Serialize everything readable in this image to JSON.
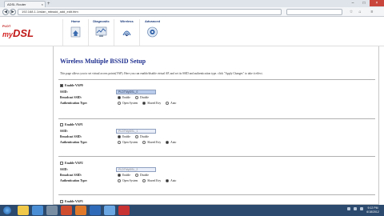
{
  "browser": {
    "tab_title": "ADSL Router",
    "tab_close": "×",
    "new_tab": "+",
    "window_buttons": [
      "–",
      "□",
      "×"
    ],
    "url": "192.168.1.1/wlan_mbssid_add_edit.htm",
    "search_placeholder": "",
    "back": "◀",
    "forward": "▶",
    "tools": [
      "☆",
      "⌂",
      "≡"
    ]
  },
  "router": {
    "logo_small": "PLDT",
    "logo_my": "my",
    "logo_main": "DSL",
    "nav": [
      {
        "label": "Home",
        "icon": "home-icon"
      },
      {
        "label": "Diagnostic",
        "icon": "diagnostic-icon"
      },
      {
        "label": "Wireless",
        "icon": "wireless-icon"
      },
      {
        "label": "Advanced",
        "icon": "advanced-icon"
      }
    ]
  },
  "page": {
    "title": "Wireless Multiple BSSID Setup",
    "description": "This page allows you to set virtual access points(VAP). Here you can enable/disable virtual AP, and set its SSID and authentication type. click \"Apply Changes\" to take it effect.",
    "labels": {
      "ssid": "SSID:",
      "broadcast": "Broadcast SSID:",
      "auth": "Authentication Type:",
      "enable": "Enable",
      "disable": "Disable",
      "open": "Open System",
      "shared": "Shared Key",
      "auto": "Auto"
    },
    "vaps": [
      {
        "enable_label": "Enable VAP0",
        "ssid": "PLDTMyDSL_0",
        "checked": true
      },
      {
        "enable_label": "Enable VAP1",
        "ssid": "PLDTMyDSL_1",
        "checked": false
      },
      {
        "enable_label": "Enable VAP2",
        "ssid": "PLDTMyDSL_2",
        "checked": false
      },
      {
        "enable_label": "Enable VAP3",
        "ssid": "",
        "checked": false
      }
    ]
  },
  "taskbar": {
    "time": "9:12 PM",
    "date": "6/18/2012"
  },
  "colors": {
    "title_blue": "#1f2f8f",
    "logo_red": "#c01818",
    "taskbar": "#2c4a6e"
  }
}
